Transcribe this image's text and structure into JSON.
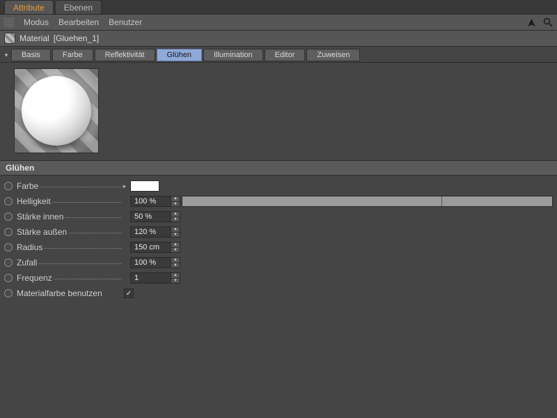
{
  "window_tabs": {
    "active": "Attribute",
    "inactive": "Ebenen"
  },
  "menu": {
    "modus": "Modus",
    "bearbeiten": "Bearbeiten",
    "benutzer": "Benutzer"
  },
  "object": {
    "prefix": "Material",
    "name": "[Gluehen_1]"
  },
  "channels": {
    "basis": "Basis",
    "farbe": "Farbe",
    "reflektivitaet": "Reflektivität",
    "gluehen": "Glühen",
    "illumination": "Illumination",
    "editor": "Editor",
    "zuweisen": "Zuweisen"
  },
  "section_title": "Glühen",
  "params": {
    "farbe": {
      "label": "Farbe",
      "swatch": "#ffffff"
    },
    "helligkeit": {
      "label": "Helligkeit",
      "value": "100 %"
    },
    "staerke_innen": {
      "label": "Stärke innen",
      "value": "50 %"
    },
    "staerke_aussen": {
      "label": "Stärke außen",
      "value": "120 %"
    },
    "radius": {
      "label": "Radius",
      "value": "150 cm"
    },
    "zufall": {
      "label": "Zufall",
      "value": "100 %"
    },
    "frequenz": {
      "label": "Frequenz",
      "value": "1"
    },
    "materialfarbe": {
      "label": "Materialfarbe benutzen",
      "checked": true
    }
  }
}
